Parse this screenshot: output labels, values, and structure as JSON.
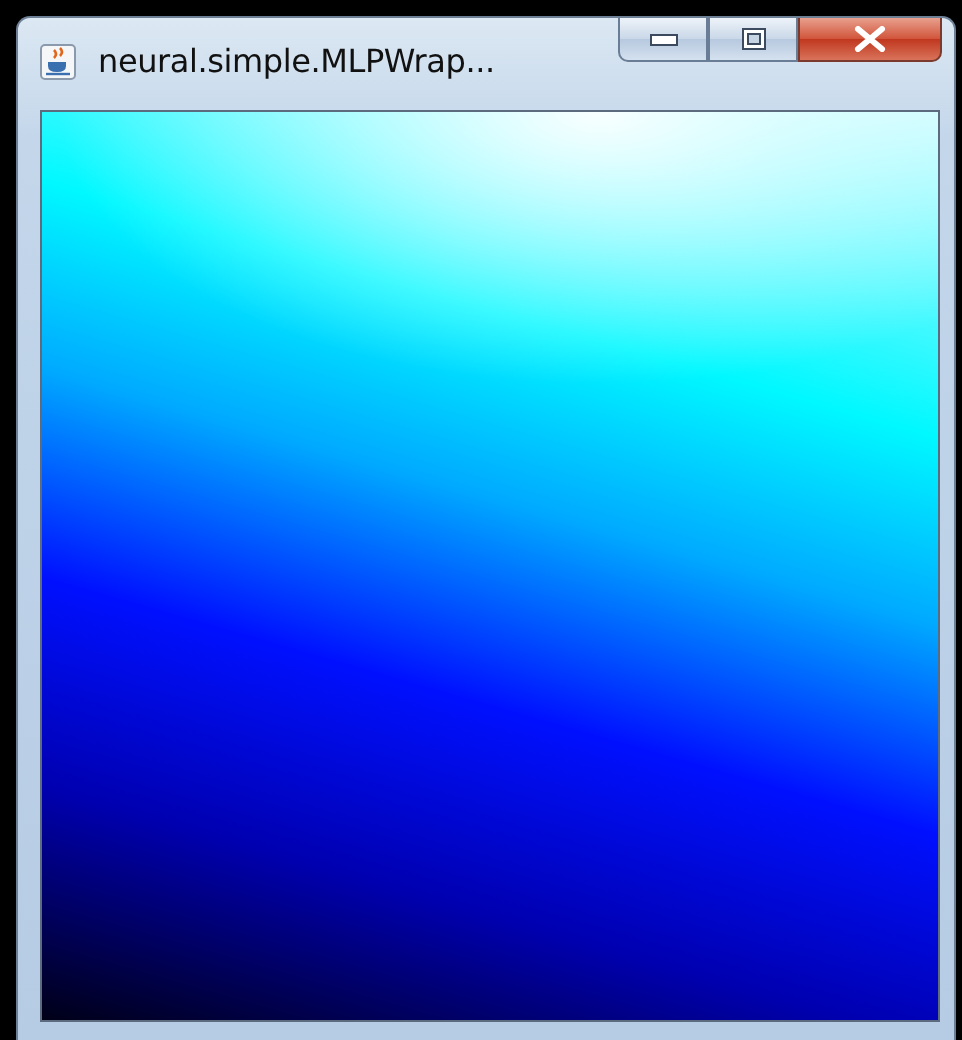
{
  "window": {
    "title": "neural.simple.MLPWrap..."
  }
}
